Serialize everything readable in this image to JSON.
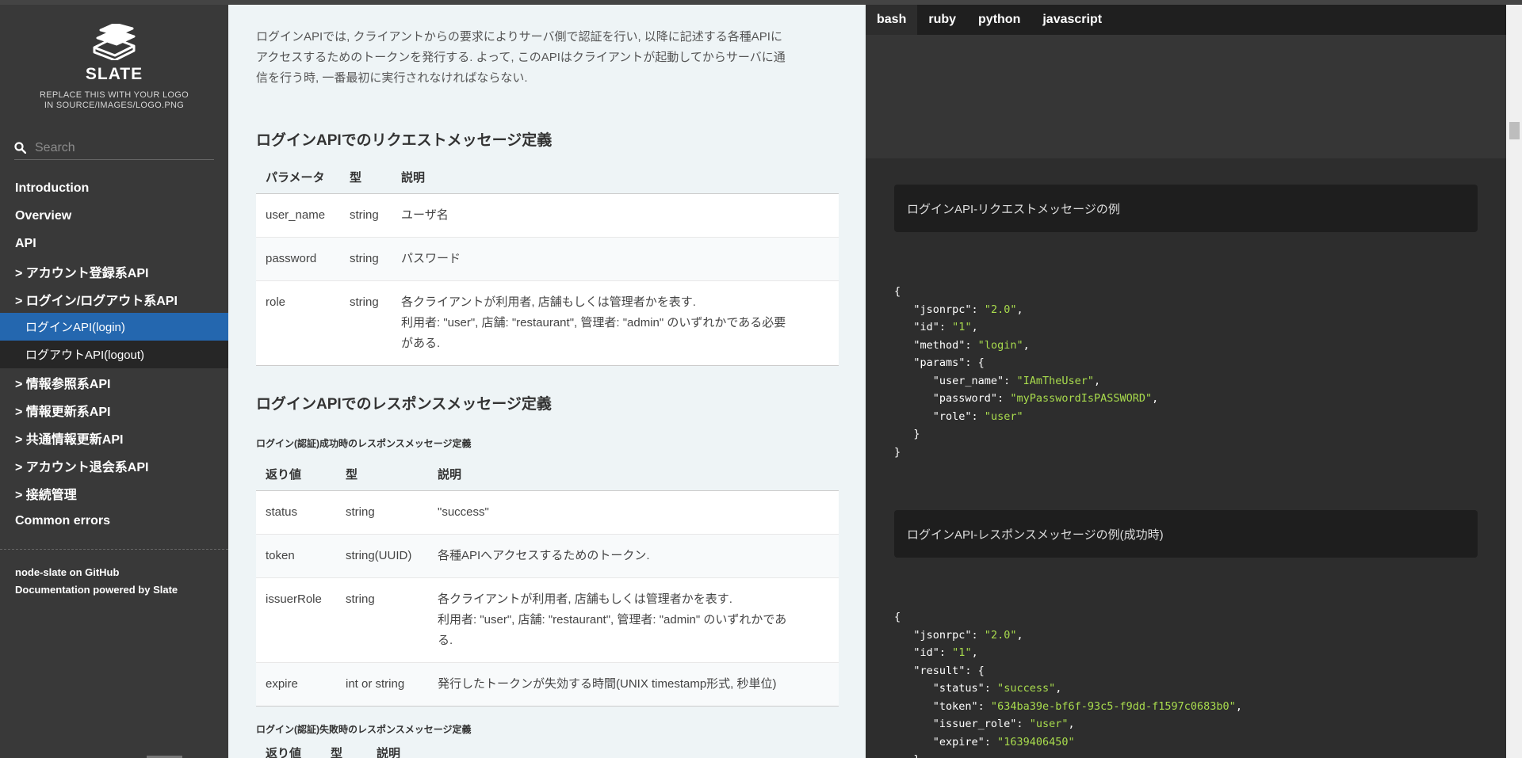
{
  "sidebar": {
    "brand": "SLATE",
    "logo_note_line1": "REPLACE THIS WITH YOUR LOGO",
    "logo_note_line2": "IN SOURCE/IMAGES/LOGO.PNG",
    "search_placeholder": "Search",
    "toc": [
      {
        "label": "Introduction"
      },
      {
        "label": "Overview"
      },
      {
        "label": "API"
      },
      {
        "label": "> アカウント登録系API"
      },
      {
        "label": "> ログイン/ログアウト系API"
      },
      {
        "label": "ログインAPI(login)"
      },
      {
        "label": "ログアウトAPI(logout)"
      },
      {
        "label": "> 情報参照系API"
      },
      {
        "label": "> 情報更新系API"
      },
      {
        "label": "> 共通情報更新API"
      },
      {
        "label": "> アカウント退会系API"
      },
      {
        "label": "> 接続管理"
      },
      {
        "label": "Common errors"
      }
    ],
    "footer": {
      "github": "node-slate on GitHub",
      "powered": "Documentation powered by Slate"
    }
  },
  "content": {
    "intro_line1": "ログインAPIでは, クライアントからの要求によりサーバ側で認証を行い, 以降に記述する各種APIに",
    "intro_line2": "アクセスするためのトークンを発行する. よって, このAPIはクライアントが起動してからサーバに通",
    "intro_line3": "信を行う時, 一番最初に実行されなければならない.",
    "request_heading": "ログインAPIでのリクエストメッセージ定義",
    "request_table": {
      "headers": [
        "パラメータ",
        "型",
        "説明"
      ],
      "rows": [
        {
          "name": "user_name",
          "type": "string",
          "desc1": "ユーザ名",
          "desc2": "",
          "desc3": ""
        },
        {
          "name": "password",
          "type": "string",
          "desc1": "パスワード",
          "desc2": "",
          "desc3": ""
        },
        {
          "name": "role",
          "type": "string",
          "desc1": "各クライアントが利用者, 店舗もしくは管理者かを表す.",
          "desc2": "利用者: \"user\", 店舗: \"restaurant\", 管理者: \"admin\" のいずれかである必要",
          "desc3": "がある."
        }
      ]
    },
    "response_heading": "ログインAPIでのレスポンスメッセージ定義",
    "success_subheading": "ログイン(認証)成功時のレスポンスメッセージ定義",
    "success_table": {
      "headers": [
        "返り値",
        "型",
        "説明"
      ],
      "rows": [
        {
          "name": "status",
          "type": "string",
          "desc1": "\"success\"",
          "desc2": "",
          "desc3": ""
        },
        {
          "name": "token",
          "type": "string(UUID)",
          "desc1": "各種APIへアクセスするためのトークン.",
          "desc2": "",
          "desc3": ""
        },
        {
          "name": "issuerRole",
          "type": "string",
          "desc1": "各クライアントが利用者, 店舗もしくは管理者かを表す.",
          "desc2": "利用者: \"user\", 店舗: \"restaurant\", 管理者: \"admin\" のいずれかであ",
          "desc3": "る."
        },
        {
          "name": "expire",
          "type": "int or string",
          "desc1": "発行したトークンが失効する時間(UNIX timestamp形式, 秒単位)",
          "desc2": "",
          "desc3": ""
        }
      ]
    },
    "failure_subheading": "ログイン(認証)失敗時のレスポンスメッセージ定義",
    "failure_table": {
      "headers": [
        "返り値",
        "型",
        "説明"
      ]
    }
  },
  "code": {
    "tabs": [
      "bash",
      "ruby",
      "python",
      "javascript"
    ],
    "active_tab": "bash",
    "request_example_title": "ログインAPI-リクエストメッセージの例",
    "request_json": {
      "jsonrpc": "2.0",
      "id": "1",
      "method": "login",
      "user_name": "IAmTheUser",
      "password": "myPasswordIsPASSWORD",
      "role": "user"
    },
    "response_example_title": "ログインAPI-レスポンスメッセージの例(成功時)",
    "response_json": {
      "jsonrpc": "2.0",
      "id": "1",
      "status": "success",
      "token": "634ba39e-bf6f-93c5-f9dd-f1597c0683b0",
      "issuer_role": "user",
      "expire": "1639406450"
    }
  },
  "colors": {
    "sidebar_bg": "#393939",
    "active_item": "#2467af",
    "code_bg": "#2d2d2d",
    "json_string": "#a9dc4d"
  }
}
